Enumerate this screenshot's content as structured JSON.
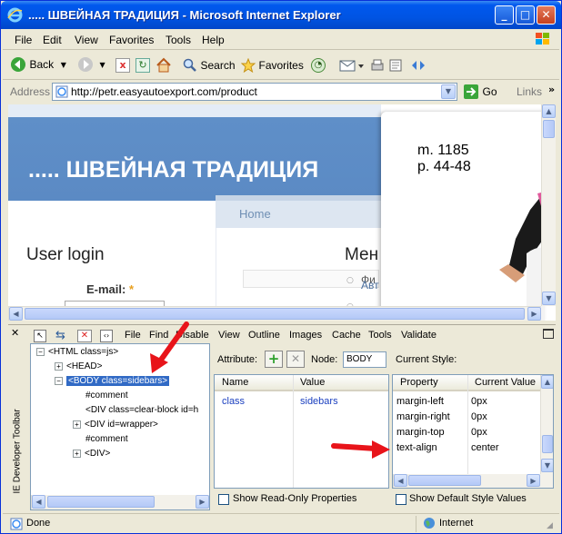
{
  "window": {
    "title": "..... ШВЕЙНАЯ ТРАДИЦИЯ - Microsoft Internet Explorer"
  },
  "menubar": {
    "items": [
      "File",
      "Edit",
      "View",
      "Favorites",
      "Tools",
      "Help"
    ]
  },
  "toolbar": {
    "back": "Back",
    "search": "Search",
    "favorites": "Favorites"
  },
  "addressbar": {
    "label": "Address",
    "url": "http://petr.easyautoexport.com/product",
    "go": "Go",
    "links": "Links"
  },
  "page": {
    "site_title": "..... ШВЕЙНАЯ ТРАДИЦИЯ",
    "nav_home": "Home",
    "user_login": "User login",
    "email_label": "E-mail:",
    "required_mark": "*",
    "menu_heading": "Мен",
    "menu_link": "Фи",
    "menu_link2": "Авт",
    "product_line1": "m. 1185",
    "product_line2": "p. 44-48"
  },
  "devtoolbar": {
    "side_label": "IE Developer Toolbar",
    "menu": [
      "File",
      "Find",
      "Disable",
      "View",
      "Outline",
      "Images",
      "Cache",
      "Tools",
      "Validate"
    ],
    "tree": [
      {
        "text": "<HTML class=js>",
        "exp": "−"
      },
      {
        "text": "<HEAD>",
        "exp": "+"
      },
      {
        "text": "<BODY class=sidebars>",
        "exp": "−"
      },
      {
        "text": "#comment",
        "exp": ""
      },
      {
        "text": "<DIV class=clear-block id=h",
        "exp": ""
      },
      {
        "text": "<DIV id=wrapper>",
        "exp": "+"
      },
      {
        "text": "#comment",
        "exp": ""
      },
      {
        "text": "<DIV>",
        "exp": "+"
      }
    ],
    "attr": {
      "label": "Attribute:",
      "node_label": "Node:",
      "node_value": "BODY",
      "col_name": "Name",
      "col_value": "Value",
      "row_name": "class",
      "row_value": "sidebars",
      "readonly": "Show Read-Only Properties"
    },
    "style": {
      "label": "Current Style:",
      "col_property": "Property",
      "col_value": "Current Value",
      "rows": [
        {
          "p": "margin-left",
          "v": "0px"
        },
        {
          "p": "margin-right",
          "v": "0px"
        },
        {
          "p": "margin-top",
          "v": "0px"
        },
        {
          "p": "text-align",
          "v": "center"
        }
      ],
      "default_style": "Show Default Style Values"
    }
  },
  "statusbar": {
    "status": "Done",
    "zone": "Internet"
  },
  "colors": {
    "title_blue": "#0054e3",
    "banner": "#5f8fc8",
    "arrow": "#e8141a"
  }
}
